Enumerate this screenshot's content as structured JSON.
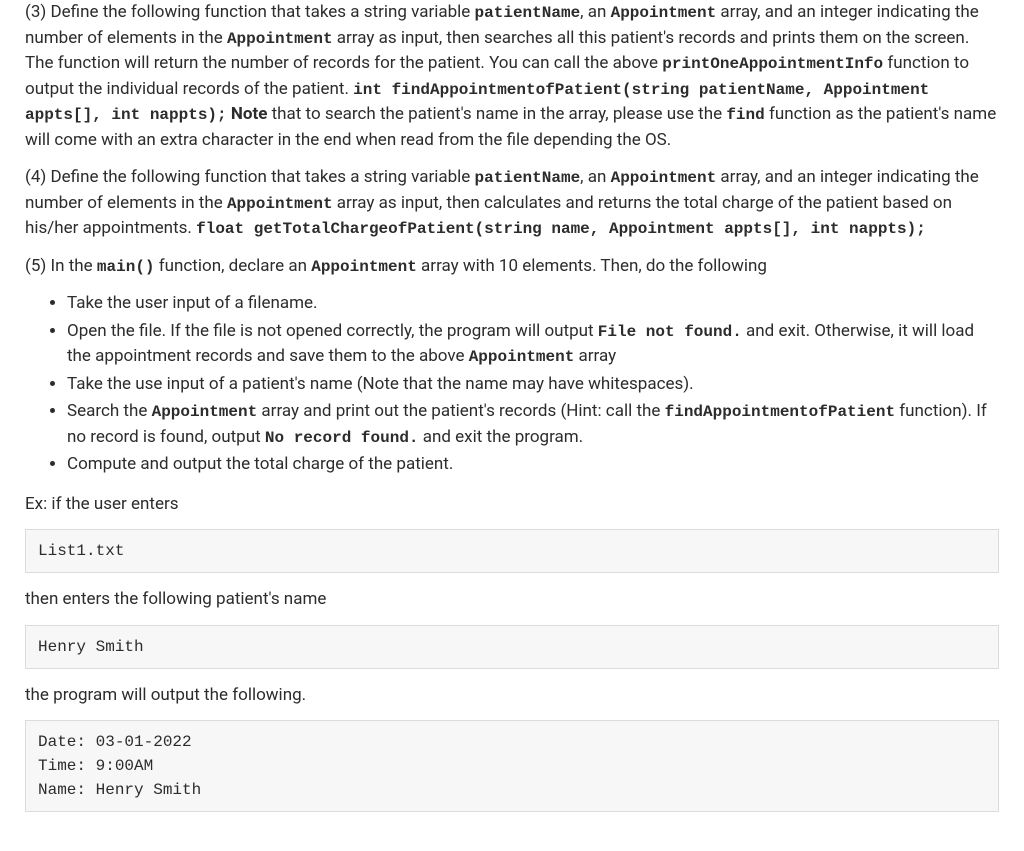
{
  "p3": {
    "t1": "(3) Define the following function that takes a string variable ",
    "c1": "patientName",
    "t2": ", an ",
    "c2": "Appointment",
    "t3": " array, and an integer indicating the number of elements in the ",
    "c3": "Appointment",
    "t4": " array as input, then searches all this patient's records and prints them on the screen. The function will return the number of records for the patient. You can call the above ",
    "c4": "printOneAppointmentInfo",
    "t5": " function to output the individual records of the patient. ",
    "c5": "int findAppointmentofPatient(string patientName, Appointment appts[], int nappts);",
    "t6": " ",
    "b1": "Note",
    "t7": " that to search the patient's name in the array, please use the ",
    "c6": "find",
    "t8": " function as the patient's name will come with an extra character in the end when read from the file depending the OS."
  },
  "p4": {
    "t1": "(4) Define the following function that takes a string variable ",
    "c1": "patientName",
    "t2": ", an ",
    "c2": "Appointment",
    "t3": " array, and an integer indicating the number of elements in the ",
    "c3": "Appointment",
    "t4": " array as input, then calculates and returns the total charge of the patient based on his/her appointments. ",
    "c4": "float getTotalChargeofPatient(string name, Appointment appts[], int nappts);"
  },
  "p5": {
    "t1": "(5) In the ",
    "c1": "main()",
    "t2": " function, declare an ",
    "c2": "Appointment",
    "t3": " array with 10 elements. Then, do the following"
  },
  "li1": "Take the user input of a filename.",
  "li2": {
    "t1": "Open the file. If the file is not opened correctly, the program will output ",
    "c1": "File not found.",
    "t2": " and exit. Otherwise, it will load the appointment records and save them to the above ",
    "c2": "Appointment",
    "t3": " array"
  },
  "li3": "Take the use input of a patient's name (Note that the name may have whitespaces).",
  "li4": {
    "t1": "Search the ",
    "c1": "Appointment",
    "t2": " array and print out the patient's records (Hint: call the ",
    "c2": "findAppointmentofPatient",
    "t3": " function). If no record is found, output ",
    "c3": "No record found.",
    "t4": " and exit the program."
  },
  "li5": "Compute and output the total charge of the patient.",
  "ex1": "Ex: if the user enters",
  "cb1": "List1.txt",
  "ex2": "then enters the following patient's name",
  "cb2": "Henry Smith",
  "ex3": "the program will output the following.",
  "cb3": "Date: 03-01-2022\nTime: 9:00AM\nName: Henry Smith"
}
